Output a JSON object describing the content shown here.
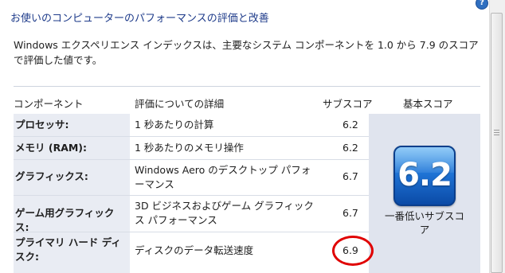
{
  "header": {
    "title": "お使いのコンピューターのパフォーマンスの評価と改善",
    "help_icon": "?"
  },
  "description": "Windows エクスペリエンス インデックスは、主要なシステム コンポーネントを 1.0 から 7.9 のスコアで評価した値です。",
  "table": {
    "columns": {
      "component": "コンポーネント",
      "detail": "評価についての詳細",
      "subscore": "サブスコア",
      "basescore": "基本スコア"
    },
    "rows": [
      {
        "component": "プロセッサ:",
        "detail": "1 秒あたりの計算",
        "subscore": "6.2"
      },
      {
        "component": "メモリ (RAM):",
        "detail": "1 秒あたりのメモリ操作",
        "subscore": "6.2"
      },
      {
        "component": "グラフィックス:",
        "detail": "Windows Aero のデスクトップ パフォーマンス",
        "subscore": "6.7"
      },
      {
        "component": "ゲーム用グラフィックス:",
        "detail": "3D ビジネスおよびゲーム グラフィックス パフォーマンス",
        "subscore": "6.7"
      },
      {
        "component": "プライマリ ハード ディスク:",
        "detail": "ディスクのデータ転送速度",
        "subscore": "6.9"
      }
    ],
    "base_score": {
      "value": "6.2",
      "caption": "一番低いサブスコア"
    }
  },
  "colors": {
    "title": "#1e3b8a",
    "badge": "#1f74d6",
    "highlight": "#e00000"
  }
}
